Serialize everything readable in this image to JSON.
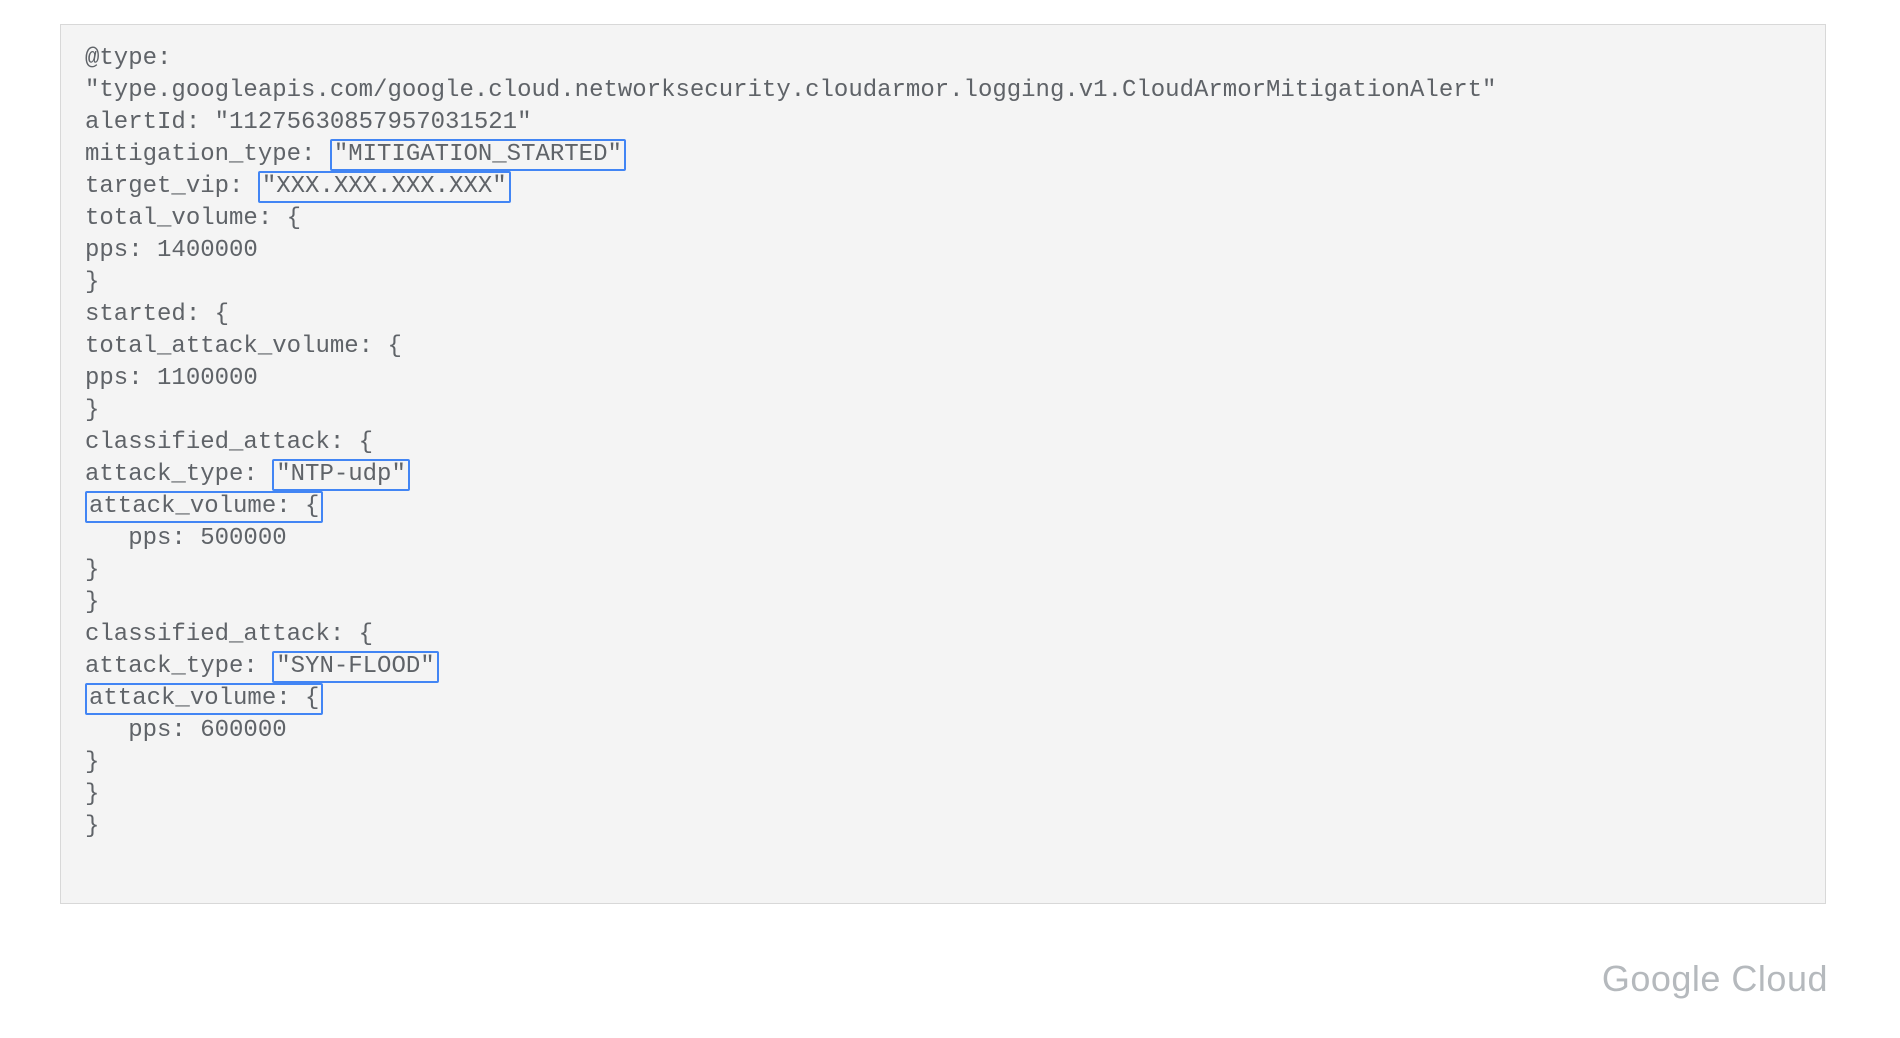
{
  "log": {
    "lines": [
      {
        "segs": [
          {
            "t": "@type:"
          }
        ]
      },
      {
        "segs": [
          {
            "t": "\"type.googleapis.com/google.cloud.networksecurity.cloudarmor.logging.v1.CloudArmorMitigationAlert\""
          }
        ]
      },
      {
        "segs": [
          {
            "t": "alertId: \"11275630857957031521\""
          }
        ]
      },
      {
        "segs": [
          {
            "t": "mitigation_type: "
          },
          {
            "t": "\"MITIGATION_STARTED\"",
            "hl": true
          }
        ]
      },
      {
        "segs": [
          {
            "t": "target_vip: "
          },
          {
            "t": "\"XXX.XXX.XXX.XXX\"",
            "hl": true
          }
        ]
      },
      {
        "segs": [
          {
            "t": "total_volume: {"
          }
        ]
      },
      {
        "segs": [
          {
            "t": "pps: 1400000"
          }
        ]
      },
      {
        "segs": [
          {
            "t": "}"
          }
        ]
      },
      {
        "segs": [
          {
            "t": "started: {"
          }
        ]
      },
      {
        "segs": [
          {
            "t": "total_attack_volume: {"
          }
        ]
      },
      {
        "segs": [
          {
            "t": "pps: 1100000"
          }
        ]
      },
      {
        "segs": [
          {
            "t": "}"
          }
        ]
      },
      {
        "segs": [
          {
            "t": "classified_attack: {"
          }
        ]
      },
      {
        "segs": [
          {
            "t": "attack_type: "
          },
          {
            "t": "\"NTP-udp\"",
            "hl": true
          }
        ]
      },
      {
        "segs": [
          {
            "t": "attack_volume: {",
            "hl": true
          }
        ]
      },
      {
        "segs": [
          {
            "t": "   pps: 500000"
          }
        ]
      },
      {
        "segs": [
          {
            "t": "}"
          }
        ]
      },
      {
        "segs": [
          {
            "t": "}"
          }
        ]
      },
      {
        "segs": [
          {
            "t": "classified_attack: {"
          }
        ]
      },
      {
        "segs": [
          {
            "t": "attack_type: "
          },
          {
            "t": "\"SYN-FLOOD\"",
            "hl": true
          }
        ]
      },
      {
        "segs": [
          {
            "t": "attack_volume: {",
            "hl": true
          }
        ]
      },
      {
        "segs": [
          {
            "t": "   pps: 600000"
          }
        ]
      },
      {
        "segs": [
          {
            "t": "}"
          }
        ]
      },
      {
        "segs": [
          {
            "t": "}"
          }
        ]
      },
      {
        "segs": [
          {
            "t": "}"
          }
        ]
      }
    ]
  },
  "attribution": "Google Cloud"
}
